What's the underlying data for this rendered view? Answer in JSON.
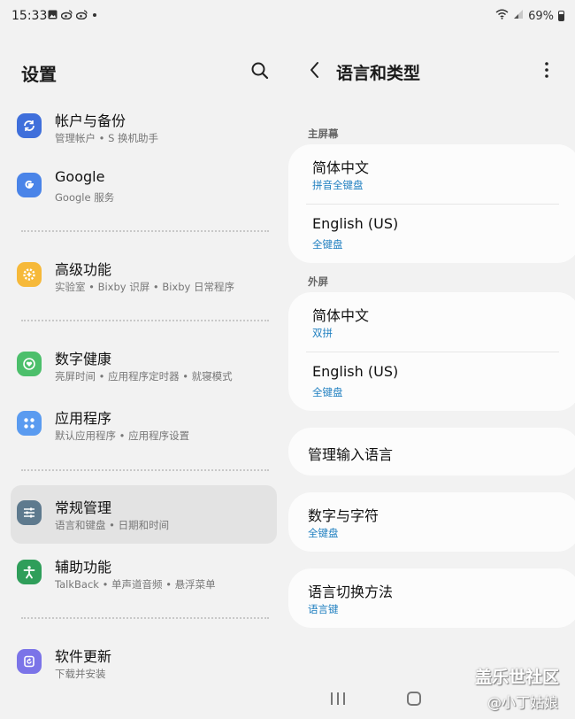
{
  "status_bar": {
    "time": "15:33",
    "battery": "69%",
    "left_icons": [
      "image-icon",
      "weibo-icon",
      "weibo-icon",
      "dot-icon"
    ],
    "right_icons": [
      "wifi-icon",
      "signal-icon",
      "battery-icon"
    ]
  },
  "left_pane": {
    "title": "设置",
    "items": [
      {
        "title": "帐户与备份",
        "subtitle": "管理帐户 • S 换机助手",
        "icon": "sync-icon",
        "color": "#3f6fdb"
      },
      {
        "title": "Google",
        "subtitle": "Google 服务",
        "icon": "google-icon",
        "color": "#4a84e8"
      },
      {
        "title": "高级功能",
        "subtitle": "实验室 • Bixby 识屏 • Bixby 日常程序",
        "icon": "gear-plus-icon",
        "color": "#f6b93a"
      },
      {
        "title": "数字健康",
        "subtitle": "亮屏时间 • 应用程序定时器 • 就寝模式",
        "icon": "heart-circle-icon",
        "color": "#4cbf6b"
      },
      {
        "title": "应用程序",
        "subtitle": "默认应用程序 • 应用程序设置",
        "icon": "apps-grid-icon",
        "color": "#5a9bf0"
      },
      {
        "title": "常规管理",
        "subtitle": "语言和键盘 • 日期和时间",
        "icon": "sliders-icon",
        "color": "#5e7a8e"
      },
      {
        "title": "辅助功能",
        "subtitle": "TalkBack • 单声道音频 • 悬浮菜单",
        "icon": "accessibility-icon",
        "color": "#2f9e5a"
      },
      {
        "title": "软件更新",
        "subtitle": "下载并安装",
        "icon": "update-icon",
        "color": "#7b74e8"
      }
    ]
  },
  "right_pane": {
    "title": "语言和类型",
    "sections": [
      {
        "label": "主屏幕",
        "rows": [
          {
            "title": "简体中文",
            "subtitle": "拼音全键盘"
          },
          {
            "title": "English (US)",
            "subtitle": "全键盘"
          }
        ]
      },
      {
        "label": "外屏",
        "rows": [
          {
            "title": "简体中文",
            "subtitle": "双拼"
          },
          {
            "title": "English (US)",
            "subtitle": "全键盘"
          }
        ]
      }
    ],
    "manage_languages": "管理输入语言",
    "numbers_symbols": {
      "title": "数字与字符",
      "subtitle": "全键盘"
    },
    "switch_method": {
      "title": "语言切换方法",
      "subtitle": "语言键"
    }
  },
  "watermark": {
    "line1": "盖乐世社区",
    "line2": "@小丁姑娘"
  }
}
